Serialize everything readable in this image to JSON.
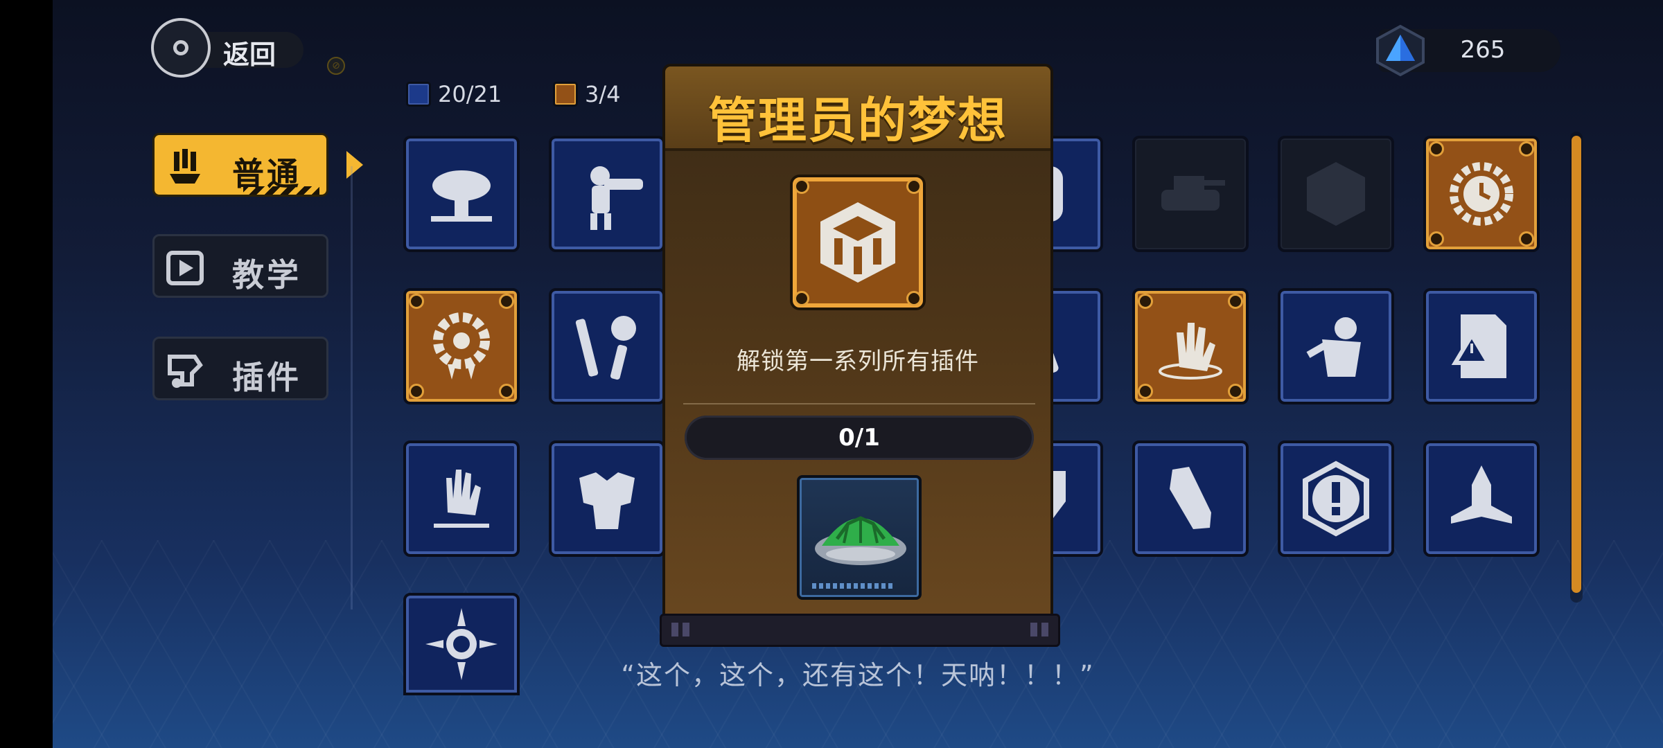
{
  "header": {
    "back_label": "返回",
    "currency_value": "265"
  },
  "counters": {
    "blue": "20/21",
    "orange": "3/4"
  },
  "tabs": [
    {
      "label": "普通",
      "icon": "claw-icon",
      "active": true
    },
    {
      "label": "教学",
      "icon": "play-icon",
      "active": false
    },
    {
      "label": "插件",
      "icon": "plugin-icon",
      "active": false
    }
  ],
  "popup": {
    "title": "管理员的梦想",
    "description": "解锁第一系列所有插件",
    "progress_text": "0/1",
    "progress": 0,
    "icon": "cube-icon",
    "reward_icon": "turtle-shell-icon"
  },
  "quote": "“这个，这个，还有这个！天呐！！！”",
  "colors": {
    "accent": "#f4b731",
    "tile_blue": "#10245e",
    "tile_orange": "#935117",
    "title": "#ffc23a"
  }
}
